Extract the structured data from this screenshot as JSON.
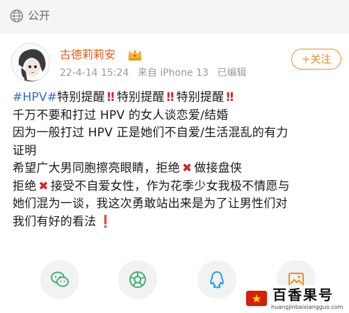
{
  "header": {
    "visibility_icon": "globe-icon",
    "visibility_label": "公开"
  },
  "author": {
    "name": "古德莉莉安",
    "badge_icon": "crown-icon",
    "date": "22-4-14 15:24",
    "source": "来自 iPhone 13",
    "edited": "已编辑"
  },
  "follow_button": {
    "label": "+关注"
  },
  "post": {
    "hashtag": "#HPV#",
    "alert_text": "特别提醒",
    "lines": [
      "千万不要和打过 HPV 的女人谈恋爱/结婚",
      "因为一般打过 HPV 正是她们不自爱/生活混乱的有力",
      "证明"
    ],
    "line5_before": "希望广大男同胞擦亮眼睛，拒绝",
    "line5_after": "做接盘侠",
    "line6_before": "拒绝",
    "line6_after": "接受不自爱女性，作为花季少女我极不情愿与",
    "line7": "她们混为一谈，我这次勇敢站出来是为了让男性们对",
    "line8": "我们有好的看法"
  },
  "share": {
    "items": [
      "wechat-icon",
      "moments-icon",
      "qq-icon",
      "image-icon"
    ]
  },
  "watermark": {
    "title": "百香果号",
    "url": "huangjinbaixiangguo.com"
  },
  "colors": {
    "accent": "#f08a24",
    "author": "#e8590c",
    "link": "#2f6fc6",
    "alert": "#e02020",
    "wechat": "#3cb371",
    "qq": "#1aa1e6"
  }
}
